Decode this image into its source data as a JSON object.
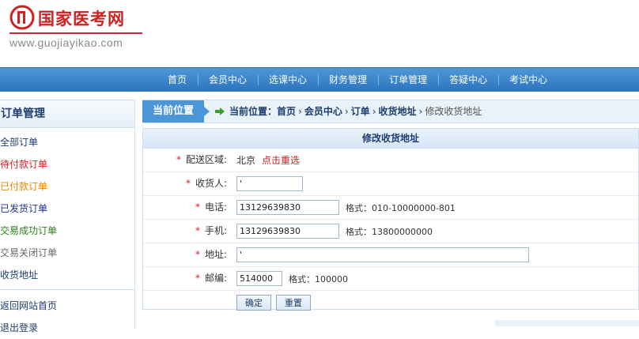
{
  "site": {
    "logo_text": "国家医考网",
    "url_text": "www.guojiayikao.com",
    "brand_color": "#d21f1f"
  },
  "nav": {
    "items": [
      "首页",
      "会员中心",
      "选课中心",
      "财务管理",
      "订单管理",
      "答疑中心",
      "考试中心"
    ]
  },
  "sidebar": {
    "title": "订单管理",
    "items": [
      {
        "label": "全部订单",
        "color": "#1d3d6e"
      },
      {
        "label": "待付款订单",
        "color": "#d21f1f"
      },
      {
        "label": "已付款订单",
        "color": "#e08a00"
      },
      {
        "label": "已发货订单",
        "color": "#1a2f9e"
      },
      {
        "label": "交易成功订单",
        "color": "#2e7d1a"
      },
      {
        "label": "交易关闭订单",
        "color": "#666666"
      },
      {
        "label": "收货地址",
        "color": "#1d3d6e"
      }
    ],
    "bottom_items": [
      {
        "label": "返回网站首页",
        "color": "#1d3d6e"
      },
      {
        "label": "退出登录",
        "color": "#1d3d6e"
      }
    ]
  },
  "breadcrumb": {
    "label": "当前位置",
    "prefix": "当前位置：",
    "path": [
      "首页",
      "会员中心",
      "订单",
      "收货地址"
    ],
    "current": "修改收货地址"
  },
  "form": {
    "title": "修改收货地址",
    "region_label": "配送区域:",
    "region_value": "北京",
    "region_link": "点击重选",
    "receiver_label": "收货人:",
    "receiver_value": "'",
    "phone_label": "电话:",
    "phone_value": "13129639830",
    "phone_hint": "格式：010-10000000-801",
    "mobile_label": "手机:",
    "mobile_value": "13129639830",
    "mobile_hint": "格式：13800000000",
    "address_label": "地址:",
    "address_value": "'",
    "zip_label": "邮编:",
    "zip_value": "514000",
    "zip_hint": "格式：100000",
    "submit_label": "确定",
    "reset_label": "重置",
    "required_mark": "*"
  }
}
